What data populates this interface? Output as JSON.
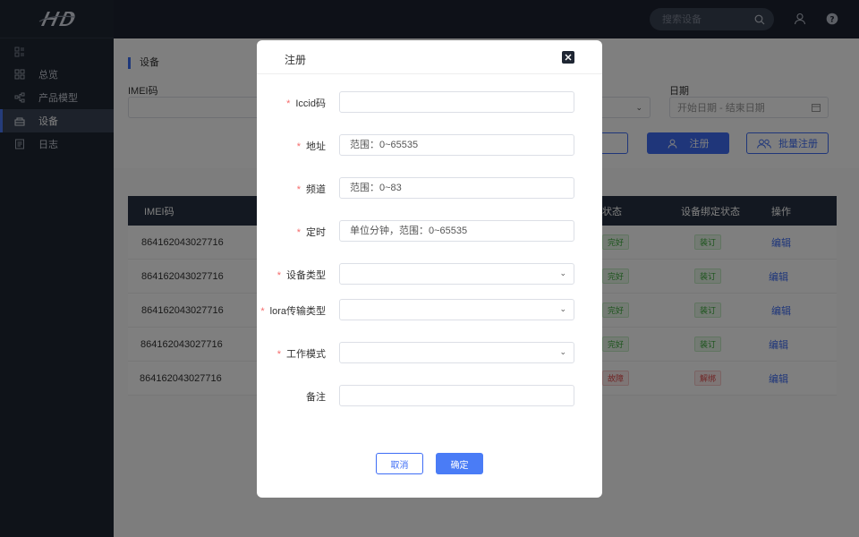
{
  "sidebar": {
    "items": [
      {
        "label": "总览",
        "icon": "grid-icon"
      },
      {
        "label": "产品模型",
        "icon": "model-icon"
      },
      {
        "label": "设备",
        "icon": "device-icon"
      },
      {
        "label": "日志",
        "icon": "log-icon"
      }
    ],
    "active_index": 2
  },
  "header": {
    "search_placeholder": "搜索设备"
  },
  "page": {
    "title": "设备",
    "filters": {
      "imei_label": "IMEI码",
      "date_label": "日期",
      "date_placeholder": "开始日期 - 结束日期"
    },
    "buttons": {
      "register": "注册",
      "batch_register": "批量注册"
    }
  },
  "table": {
    "headers": {
      "imei": "IMEI码",
      "status": "状态",
      "bind_status": "设备绑定状态",
      "action": "操作"
    },
    "rows": [
      {
        "imei": "864162043027716",
        "status": "完好",
        "bind": "装订",
        "action": "编辑",
        "bind_type": "green",
        "status_type": "green"
      },
      {
        "imei": "864162043027716",
        "status": "完好",
        "bind": "装订",
        "action": "编辑",
        "bind_type": "green",
        "status_type": "green"
      },
      {
        "imei": "864162043027716",
        "status": "完好",
        "bind": "装订",
        "action": "编辑",
        "bind_type": "green",
        "status_type": "green"
      },
      {
        "imei": "864162043027716",
        "status": "完好",
        "bind": "装订",
        "action": "编辑",
        "bind_type": "green",
        "status_type": "green"
      },
      {
        "imei": "864162043027716",
        "status": "故障",
        "bind": "解绑",
        "action": "编辑",
        "bind_type": "red",
        "status_type": "red"
      }
    ]
  },
  "modal": {
    "title": "注册",
    "close_icon": "close-icon",
    "fields": {
      "iccid": {
        "label": "Iccid码",
        "required": true,
        "placeholder": ""
      },
      "address": {
        "label": "地址",
        "required": true,
        "placeholder": "范围：0~65535"
      },
      "channel": {
        "label": "频道",
        "required": true,
        "placeholder": "范围：0~83"
      },
      "timer": {
        "label": "定时",
        "required": true,
        "placeholder": "单位分钟，范围：0~65535"
      },
      "device_type": {
        "label": "设备类型",
        "required": true,
        "value": ""
      },
      "lora_type": {
        "label": "lora传输类型",
        "required": true,
        "value": ""
      },
      "work_mode": {
        "label": "工作模式",
        "required": true,
        "value": ""
      },
      "remark": {
        "label": "备注",
        "required": false,
        "placeholder": ""
      }
    },
    "required_mark": "*",
    "cancel_label": "取消",
    "ok_label": "确定"
  },
  "colors": {
    "primary": "#3e6df5",
    "sidebar_bg": "#1f2633",
    "required": "#f56c6c"
  }
}
